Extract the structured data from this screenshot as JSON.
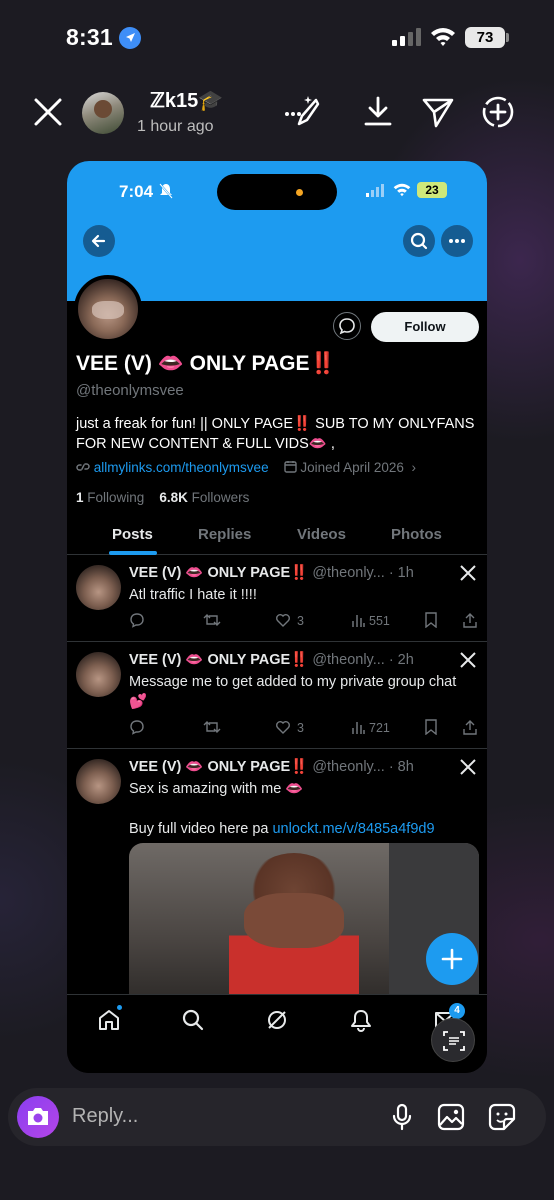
{
  "status_bar": {
    "time": "8:31",
    "battery": "73"
  },
  "story": {
    "user_name": "ℤk15🎓",
    "time_ago": "1 hour ago",
    "icons": [
      "close-icon",
      "sparkle-brush-icon",
      "download-icon",
      "send-icon",
      "add-circle-icon"
    ]
  },
  "screenshot": {
    "status_time": "7:04",
    "battery": "23",
    "profile": {
      "name": "VEE (V) 👄 ONLY PAGE‼️",
      "handle": "@theonlymsvee",
      "bio": "just a freak for fun! || ONLY PAGE‼️ SUB TO MY ONLYFANS FOR NEW CONTENT & FULL VIDS👄 ,",
      "link": "allmylinks.com/theonlymsvee",
      "joined": "Joined April 2026",
      "following_count": "1",
      "following_label": "Following",
      "followers_count": "6.8K",
      "followers_label": "Followers",
      "follow_button": "Follow"
    },
    "tabs": [
      "Posts",
      "Replies",
      "Videos",
      "Photos"
    ],
    "tweets": [
      {
        "name": "VEE (V) 👄 ONLY PAGE‼️",
        "handle_time": "@theonly... · 1h",
        "text": "Atl traffic I hate it !!!!",
        "likes": "3",
        "views": "551"
      },
      {
        "name": "VEE (V) 👄 ONLY PAGE‼️",
        "handle_time": "@theonly... · 2h",
        "text": "Message me to get added to my private group chat 💕",
        "likes": "3",
        "views": "721"
      },
      {
        "name": "VEE (V) 👄 ONLY PAGE‼️",
        "handle_time": "@theonly... · 8h",
        "text": "Sex is amazing with me 👄",
        "text2": "Buy full video here pa",
        "link": "unlockt.me/v/8485a4f9d9"
      }
    ],
    "messages_badge": "4"
  },
  "reply": {
    "placeholder": "Reply..."
  }
}
